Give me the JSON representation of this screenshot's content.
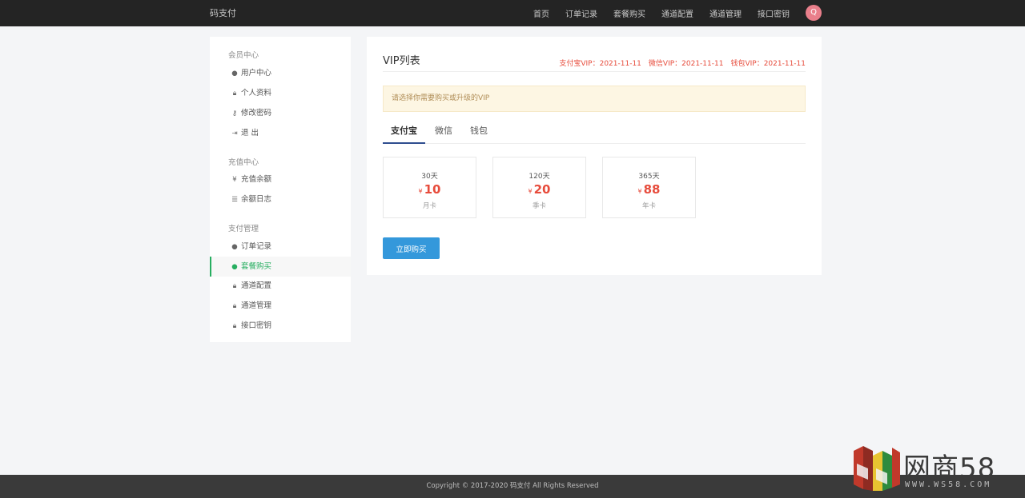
{
  "header": {
    "brand": "码支付",
    "nav": [
      "首页",
      "订单记录",
      "套餐购买",
      "通道配置",
      "通道管理",
      "接口密钥"
    ],
    "avatar_letter": "Q"
  },
  "sidebar": {
    "groups": [
      {
        "title": "会员中心",
        "items": [
          {
            "icon": "user-circle-icon",
            "label": "用户中心"
          },
          {
            "icon": "lock-icon",
            "label": "个人资料"
          },
          {
            "icon": "key-icon",
            "label": "修改密码"
          },
          {
            "icon": "logout-icon",
            "label": "退 出"
          }
        ]
      },
      {
        "title": "充值中心",
        "items": [
          {
            "icon": "yen-icon",
            "label": "充值余额"
          },
          {
            "icon": "list-icon",
            "label": "余额日志"
          }
        ]
      },
      {
        "title": "支付管理",
        "items": [
          {
            "icon": "user-circle-icon",
            "label": "订单记录"
          },
          {
            "icon": "user-circle-icon",
            "label": "套餐购买",
            "active": true
          },
          {
            "icon": "lock-icon",
            "label": "通道配置"
          },
          {
            "icon": "lock-icon",
            "label": "通道管理"
          },
          {
            "icon": "lock-icon",
            "label": "接口密钥"
          }
        ]
      }
    ]
  },
  "main": {
    "title": "VIP列表",
    "vip_status": [
      "支付宝VIP：2021-11-11",
      "微信VIP：2021-11-11",
      "钱包VIP：2021-11-11"
    ],
    "notice": "请选择你需要购买或升级的VIP",
    "tabs": [
      {
        "label": "支付宝",
        "active": true
      },
      {
        "label": "微信"
      },
      {
        "label": "钱包"
      }
    ],
    "plans": [
      {
        "days": "30天",
        "currency": "¥",
        "price": "10",
        "name": "月卡"
      },
      {
        "days": "120天",
        "currency": "¥",
        "price": "20",
        "name": "季卡"
      },
      {
        "days": "365天",
        "currency": "¥",
        "price": "88",
        "name": "年卡"
      }
    ],
    "buy_label": "立即购买"
  },
  "footer": {
    "copyright": "Copyright © 2017-2020 码支付 All Rights Reserved"
  },
  "watermark": {
    "text": "网商58",
    "sub": "WWW.WS58.COM"
  },
  "colors": {
    "accent": "#27ae60",
    "price": "#e74c3c",
    "button": "#3498db",
    "tab_active": "#2f4e8f"
  }
}
